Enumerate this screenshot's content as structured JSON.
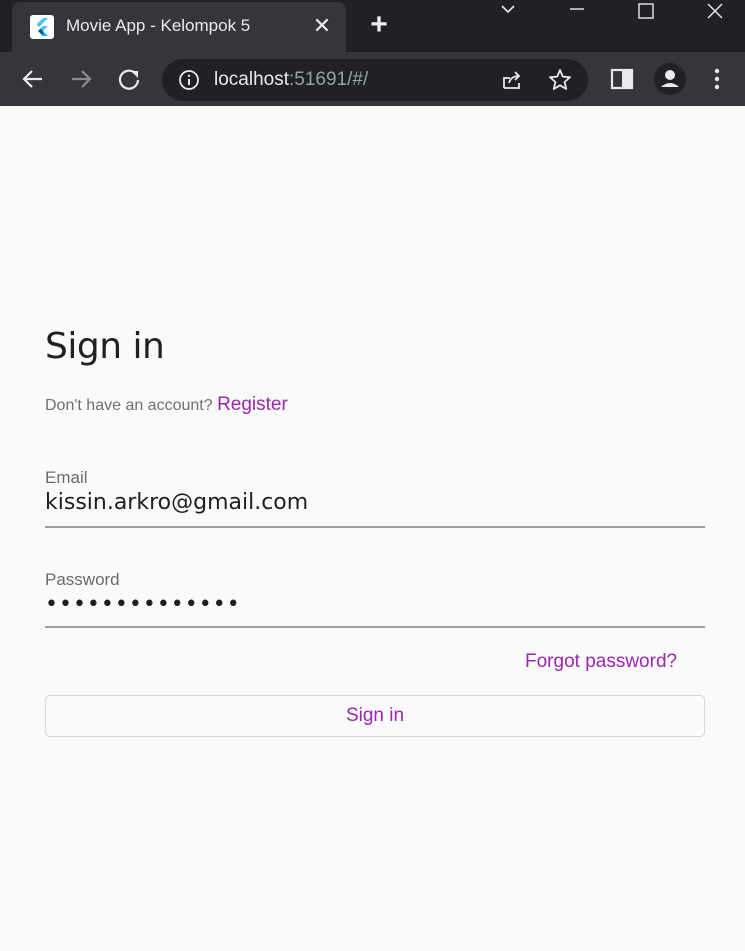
{
  "browser": {
    "tab_title": "Movie App - Kelompok 5",
    "tab_close": "✕",
    "new_tab": "+",
    "url_host": "localhost",
    "url_rest": ":51691/#/"
  },
  "signin": {
    "heading": "Sign in",
    "no_account_text": "Don't have an account?",
    "register_link": "Register",
    "email_label": "Email",
    "email_value": "kissin.arkro@gmail.com",
    "password_label": "Password",
    "password_value": "••••••••••••••",
    "forgot_link": "Forgot password?",
    "signin_button": "Sign in"
  },
  "colors": {
    "accent": "#9c27b0",
    "browser_frame": "#202124",
    "toolbar": "#35363a",
    "page_bg": "#fafafa"
  }
}
